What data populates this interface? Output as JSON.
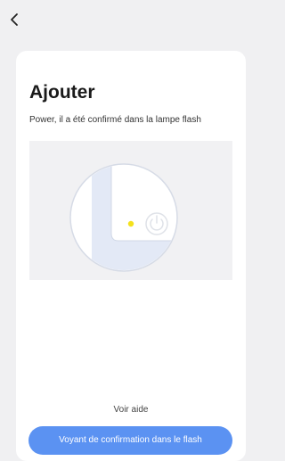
{
  "header": {
    "back_icon": "chevron-left-icon"
  },
  "card": {
    "title": "Ajouter",
    "subtitle": "Power, il a été confirmé dans la lampe flash",
    "illustration": {
      "indicator_color": "#f4e11c",
      "power_icon": "power-icon"
    },
    "help_link": "Voir aide",
    "primary_button": "Voyant de confirmation dans le flash"
  },
  "colors": {
    "background": "#f0f0f2",
    "card": "#ffffff",
    "accent": "#5b92f2",
    "indicator": "#f4e11c"
  }
}
